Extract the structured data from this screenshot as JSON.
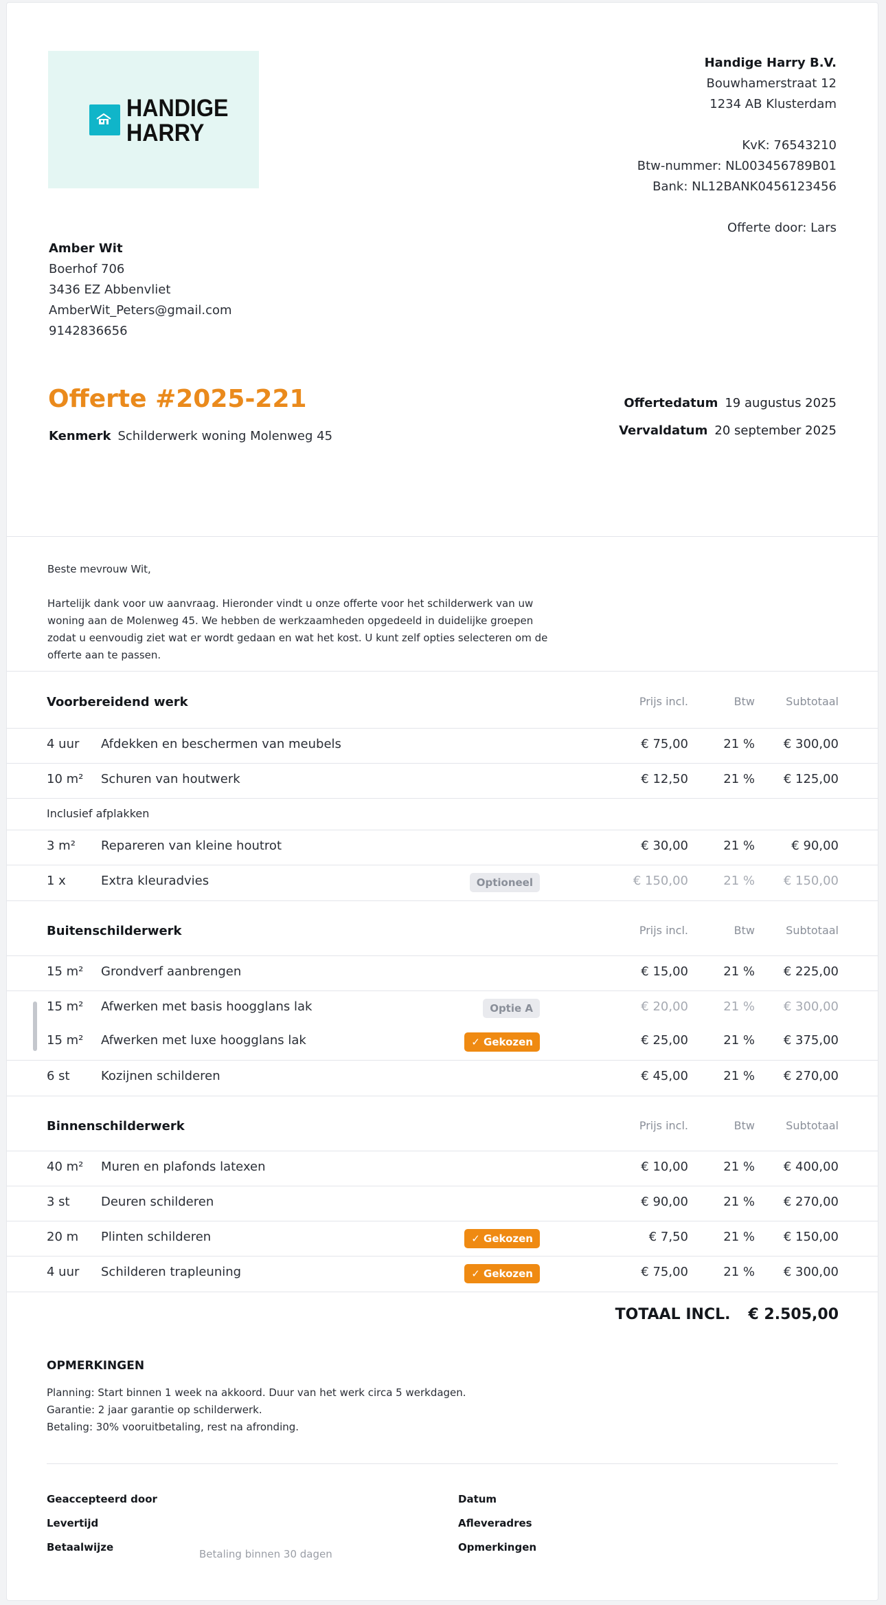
{
  "logo": {
    "line1": "HANDIGE",
    "line2": "HARRY",
    "icon": "house-icon",
    "bg": "#e4f6f3",
    "accent": "#10b5c9"
  },
  "company": {
    "name": "Handige Harry B.V.",
    "street": "Bouwhamerstraat 12",
    "city": "1234 AB Klusterdam",
    "kvk": "KvK: 76543210",
    "btw": "Btw-nummer: NL003456789B01",
    "bank": "Bank: NL12BANK0456123456",
    "author": "Offerte door: Lars"
  },
  "client": {
    "name": "Amber Wit",
    "street": "Boerhof 706",
    "city": "3436 EZ Abbenvliet",
    "email": "AmberWit_Peters@gmail.com",
    "phone": "9142836656"
  },
  "quote": {
    "title": "Offerte #2025-221",
    "kenmerk_label": "Kenmerk",
    "kenmerk_value": "Schilderwerk woning Molenweg 45",
    "date_label": "Offertedatum",
    "date_value": "19 augustus 2025",
    "due_label": "Vervaldatum",
    "due_value": "20 september 2025"
  },
  "intro": {
    "greeting": "Beste mevrouw Wit,",
    "body": "Hartelijk dank voor uw aanvraag. Hieronder vindt u onze offerte voor het schilderwerk van uw woning aan de Molenweg 45. We hebben de werkzaamheden opgedeeld in duidelijke groepen zodat u eenvoudig ziet wat er wordt gedaan en wat het kost. U kunt zelf opties selecteren om de offerte aan te passen."
  },
  "columns": {
    "price": "Prijs incl.",
    "vat": "Btw",
    "subtotal": "Subtotaal"
  },
  "sections": [
    {
      "title": "Voorbereidend werk",
      "rows": [
        {
          "qty": "4 uur",
          "desc": "Afdekken en beschermen van meubels",
          "price": "€ 75,00",
          "vat": "21 %",
          "subtotal": "€ 300,00"
        },
        {
          "qty": "10 m²",
          "desc": "Schuren van houtwerk",
          "price": "€ 12,50",
          "vat": "21 %",
          "subtotal": "€ 125,00"
        },
        {
          "note": "Inclusief afplakken"
        },
        {
          "qty": "3 m²",
          "desc": "Repareren van kleine houtrot",
          "price": "€ 30,00",
          "vat": "21 %",
          "subtotal": "€ 90,00"
        },
        {
          "qty": "1 x",
          "desc": "Extra kleuradvies",
          "badge": "Optioneel",
          "price": "€ 150,00",
          "vat": "21 %",
          "subtotal": "€ 150,00"
        }
      ]
    },
    {
      "title": "Buitenschilderwerk",
      "rows": [
        {
          "qty": "15 m²",
          "desc": "Grondverf aanbrengen",
          "price": "€ 15,00",
          "vat": "21 %",
          "subtotal": "€ 225,00"
        },
        {
          "qty": "15 m²",
          "desc": "Afwerken met basis hoogglans lak",
          "badge": "Optie A",
          "price": "€ 20,00",
          "vat": "21 %",
          "subtotal": "€ 300,00"
        },
        {
          "qty": "15 m²",
          "desc": "Afwerken met luxe hoogglans lak",
          "badge": "✓ Gekozen",
          "price": "€ 25,00",
          "vat": "21 %",
          "subtotal": "€ 375,00"
        },
        {
          "qty": "6 st",
          "desc": "Kozijnen schilderen",
          "price": "€ 45,00",
          "vat": "21 %",
          "subtotal": "€ 270,00"
        }
      ]
    },
    {
      "title": "Binnenschilderwerk",
      "rows": [
        {
          "qty": "40 m²",
          "desc": "Muren en plafonds latexen",
          "price": "€ 10,00",
          "vat": "21 %",
          "subtotal": "€ 400,00"
        },
        {
          "qty": "3 st",
          "desc": "Deuren schilderen",
          "price": "€ 90,00",
          "vat": "21 %",
          "subtotal": "€ 270,00"
        },
        {
          "qty": "20 m",
          "desc": "Plinten schilderen",
          "badge": "✓ Gekozen",
          "price": "€ 7,50",
          "vat": "21 %",
          "subtotal": "€ 150,00"
        },
        {
          "qty": "4 uur",
          "desc": "Schilderen trapleuning",
          "badge": "✓ Gekozen",
          "price": "€ 75,00",
          "vat": "21 %",
          "subtotal": "€ 300,00"
        }
      ]
    }
  ],
  "total": {
    "label": "TOTAAL INCL.",
    "value": "€ 2.505,00"
  },
  "remarks": {
    "title": "OPMERKINGEN",
    "lines": [
      "Planning: Start binnen 1 week na akkoord. Duur van het werk circa 5 werkdagen.",
      "Garantie: 2 jaar garantie op schilderwerk.",
      "Betaling: 30% vooruitbetaling, rest na afronding."
    ]
  },
  "signoff": {
    "accepted_by": "Geaccepteerd door",
    "delivery": "Levertijd",
    "payment_method": "Betaalwijze",
    "payment_value": "Betaling binnen 30 dagen",
    "date": "Datum",
    "delivery_address": "Afleveradres",
    "remarks": "Opmerkingen"
  }
}
